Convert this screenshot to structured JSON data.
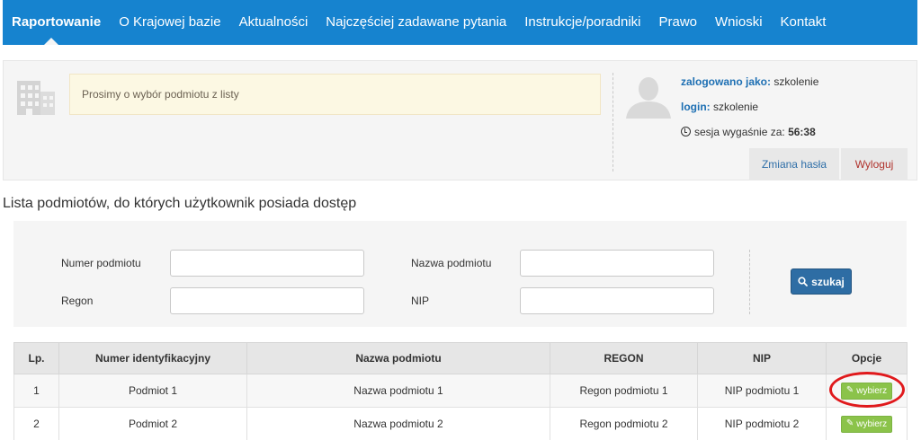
{
  "nav": {
    "items": [
      {
        "label": "Raportowanie",
        "active": true
      },
      {
        "label": "O Krajowej bazie",
        "active": false
      },
      {
        "label": "Aktualności",
        "active": false
      },
      {
        "label": "Najczęściej zadawane pytania",
        "active": false
      },
      {
        "label": "Instrukcje/poradniki",
        "active": false
      },
      {
        "label": "Prawo",
        "active": false
      },
      {
        "label": "Wnioski",
        "active": false
      },
      {
        "label": "Kontakt",
        "active": false
      }
    ],
    "color": "#1683cf"
  },
  "info": {
    "alert_text": "Prosimy o wybór podmiotu z listy",
    "logged_as_label": "zalogowano jako:",
    "logged_as_value": "szkolenie",
    "login_label": "login:",
    "login_value": "szkolenie",
    "session_label": "sesja wygaśnie za:",
    "session_value": "56:38",
    "change_password": "Zmiana hasła",
    "logout": "Wyloguj"
  },
  "section_title": "Lista podmiotów, do których użytkownik posiada dostęp",
  "search": {
    "numer_label": "Numer podmiotu",
    "nazwa_label": "Nazwa podmiotu",
    "regon_label": "Regon",
    "nip_label": "NIP",
    "numer_value": "",
    "nazwa_value": "",
    "regon_value": "",
    "nip_value": "",
    "button": "szukaj"
  },
  "table": {
    "headers": [
      "Lp.",
      "Numer identyfikacyjny",
      "Nazwa podmiotu",
      "REGON",
      "NIP",
      "Opcje"
    ],
    "rows": [
      {
        "lp": "1",
        "numer": "Podmiot 1",
        "nazwa": "Nazwa podmiotu 1",
        "regon": "Regon podmiotu 1",
        "nip": "NIP podmiotu 1",
        "action": "wybierz"
      },
      {
        "lp": "2",
        "numer": "Podmiot 2",
        "nazwa": "Nazwa podmiotu 2",
        "regon": "Regon podmiotu 2",
        "nip": "NIP podmiotu 2",
        "action": "wybierz"
      }
    ]
  },
  "colors": {
    "accent": "#1683cf",
    "select_button": "#8bc34a",
    "search_button": "#2e6da4",
    "highlight_circle": "#e0191c"
  }
}
